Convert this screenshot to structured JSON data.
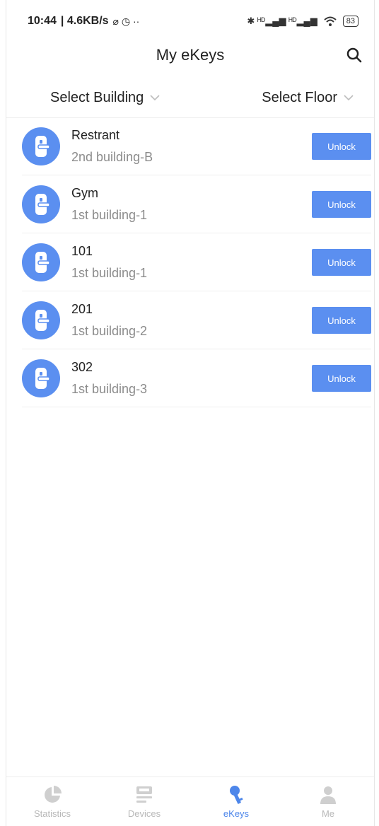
{
  "status_bar": {
    "time": "10:44",
    "net_speed": "| 4.6KB/s",
    "extra_icons": "⌀ ◷ ··",
    "signal_text": "✱ ᴴᴰ▂▄▆ ᴴᴰ▂▄▆",
    "battery": "83"
  },
  "header": {
    "title": "My eKeys"
  },
  "filters": {
    "building_label": "Select Building",
    "floor_label": "Select Floor"
  },
  "keys": [
    {
      "name": "Restrant",
      "location": "2nd building-B",
      "action": "Unlock"
    },
    {
      "name": "Gym",
      "location": "1st building-1",
      "action": "Unlock"
    },
    {
      "name": "101",
      "location": "1st building-1",
      "action": "Unlock"
    },
    {
      "name": "201",
      "location": "1st building-2",
      "action": "Unlock"
    },
    {
      "name": "302",
      "location": "1st building-3",
      "action": "Unlock"
    }
  ],
  "tabs": [
    {
      "label": "Statistics",
      "icon": "pie-chart-icon",
      "active": false
    },
    {
      "label": "Devices",
      "icon": "devices-icon",
      "active": false
    },
    {
      "label": "eKeys",
      "icon": "key-icon",
      "active": true
    },
    {
      "label": "Me",
      "icon": "user-icon",
      "active": false
    }
  ],
  "colors": {
    "accent": "#5b8ff0",
    "tab_active": "#4d86ea",
    "tab_inactive": "#b8b8b8"
  }
}
